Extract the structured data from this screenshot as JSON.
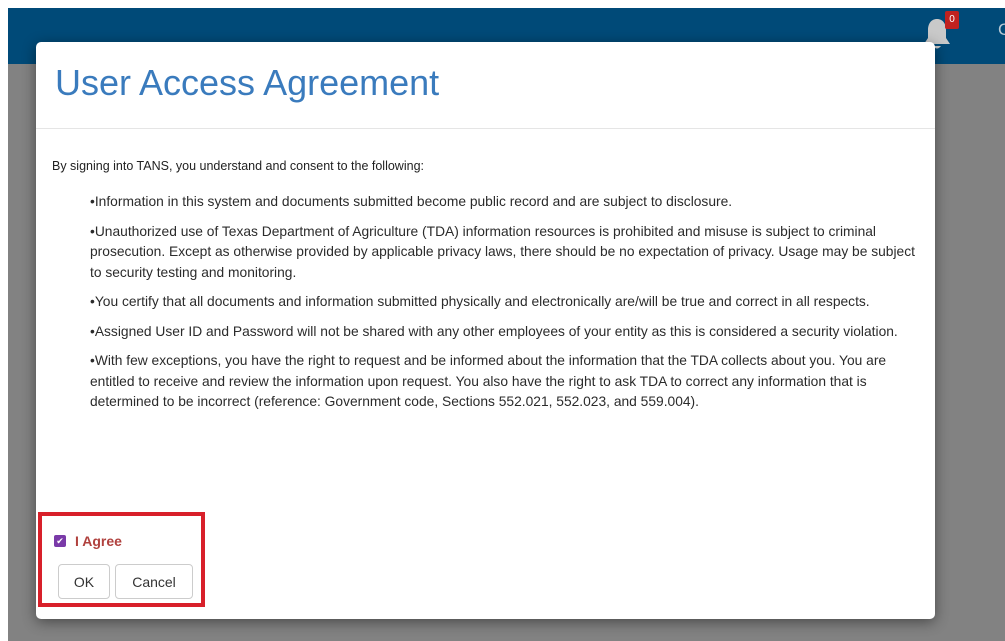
{
  "header": {
    "notification_count": "0",
    "cutoff_text": "C",
    "bar_color": "#004a78"
  },
  "modal": {
    "title": "User Access Agreement",
    "intro": "By signing into TANS, you understand and consent to the following:",
    "terms": [
      "•Information in this system and documents submitted become public record and are subject to disclosure.",
      "•Unauthorized use of Texas Department of Agriculture (TDA) information resources is prohibited and misuse is subject to criminal prosecution. Except as otherwise provided by applicable privacy laws, there should be no expectation of privacy. Usage may be subject to security testing and monitoring.",
      "•You certify that all documents and information submitted physically and electronically are/will be true and correct in all respects.",
      "•Assigned User ID and Password will not be shared with any other employees of your entity as this is considered a security violation.",
      "•With few exceptions, you have the right to request and be informed about the information that the TDA collects about you. You are entitled to receive and review the information upon request. You also have the right to ask TDA to correct any information that is determined to be incorrect (reference: Government code, Sections 552.021, 552.023, and 559.004)."
    ],
    "agree_label": "I Agree",
    "agree_checked": true,
    "ok_label": "OK",
    "cancel_label": "Cancel"
  },
  "colors": {
    "title": "#3a7bbd",
    "agree_label": "#b0413e",
    "checkbox": "#7a3aa8",
    "highlight": "#d8202a",
    "overlay": "#828282"
  }
}
